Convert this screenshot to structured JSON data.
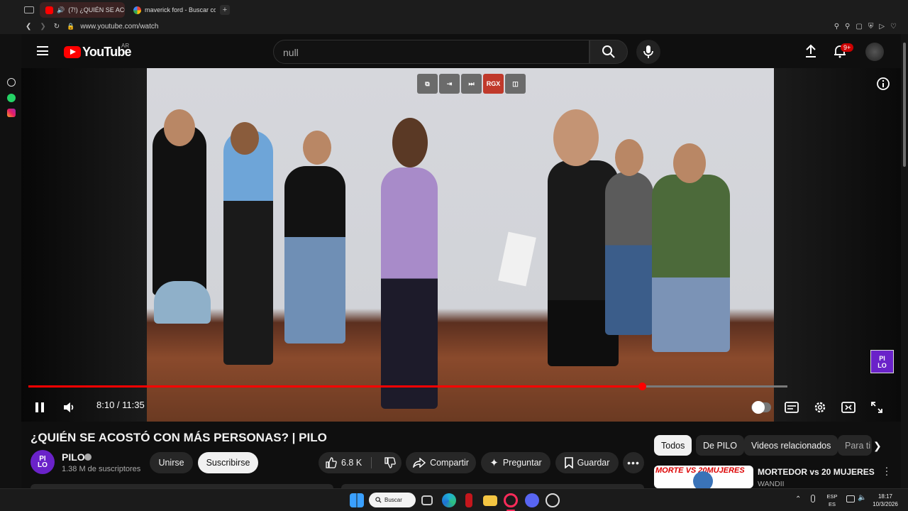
{
  "browser": {
    "tabs": [
      {
        "label": "(7!) ¿QUIÉN SE ACOST",
        "favicon": "youtube-icon"
      },
      {
        "label": "maverick ford - Buscar co",
        "favicon": "google-icon"
      }
    ],
    "new_tab_label": "+",
    "url": "www.youtube.com/watch"
  },
  "youtube": {
    "logo_text": "YouTube",
    "country_code": "AR",
    "search_value": "null",
    "notifications_badge": "9+"
  },
  "player": {
    "extension_buttons": [
      "pip",
      "exit",
      "skip",
      "RGX",
      "sidebar"
    ],
    "current_time": "8:10",
    "time_separator": " / ",
    "duration": "11:35",
    "progress": 0.808,
    "watermark": "PI LO"
  },
  "video": {
    "title": "¿QUIÉN SE ACOSTÓ CON MÁS PERSONAS? | PILO",
    "channel_name": "PILO",
    "subscribers": "1.38 M de suscriptores",
    "join_label": "Unirse",
    "subscribe_label": "Suscribirse",
    "likes": "6.8 K",
    "share_label": "Compartir",
    "ask_label": "Preguntar",
    "save_label": "Guardar"
  },
  "chips": [
    "Todos",
    "De PILO",
    "Videos relacionados",
    "Para ti"
  ],
  "recommended": {
    "title": "MORTEDOR vs 20 MUJERES",
    "channel": "WANDII",
    "thumb_text": "MORTE VS 20MUJERES"
  },
  "taskbar": {
    "search_label": "Buscar",
    "lang_top": "ESP",
    "lang_bottom": "ES",
    "time": "18:17",
    "date": "10/3/2026"
  },
  "colors": {
    "accent_red": "#ff0000",
    "brand_purple": "#6a22c9",
    "rgx_red": "#c0392b"
  }
}
